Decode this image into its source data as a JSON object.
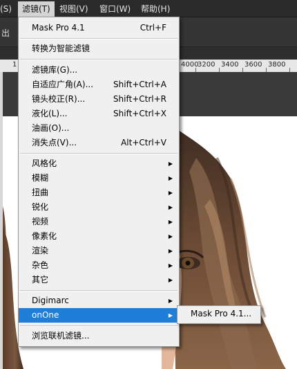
{
  "menubar": {
    "items": [
      {
        "label": "(S)"
      },
      {
        "label": "滤镜(T)"
      },
      {
        "label": "视图(V)"
      },
      {
        "label": "窗口(W)"
      },
      {
        "label": "帮助(H)"
      }
    ]
  },
  "optbar": {
    "text": "出"
  },
  "ruler": {
    "labels": [
      "1",
      "3200",
      "3400",
      "3600",
      "3800",
      "4000"
    ]
  },
  "filter_menu": {
    "items": [
      {
        "label": "Mask Pro 4.1",
        "shortcut": "Ctrl+F"
      },
      {
        "label": "转换为智能滤镜"
      },
      {
        "label": "滤镜库(G)..."
      },
      {
        "label": "自适应广角(A)...",
        "shortcut": "Shift+Ctrl+A"
      },
      {
        "label": "镜头校正(R)...",
        "shortcut": "Shift+Ctrl+R"
      },
      {
        "label": "液化(L)...",
        "shortcut": "Shift+Ctrl+X"
      },
      {
        "label": "油画(O)..."
      },
      {
        "label": "消失点(V)...",
        "shortcut": "Alt+Ctrl+V"
      },
      {
        "label": "风格化"
      },
      {
        "label": "模糊"
      },
      {
        "label": "扭曲"
      },
      {
        "label": "锐化"
      },
      {
        "label": "视频"
      },
      {
        "label": "像素化"
      },
      {
        "label": "渲染"
      },
      {
        "label": "杂色"
      },
      {
        "label": "其它"
      },
      {
        "label": "Digimarc"
      },
      {
        "label": "onOne"
      },
      {
        "label": "浏览联机滤镜..."
      }
    ],
    "submenu_arrow": "▶",
    "highlight_color": "#1f7fd8"
  },
  "onone_submenu": {
    "items": [
      {
        "label": "Mask Pro 4.1..."
      }
    ]
  }
}
